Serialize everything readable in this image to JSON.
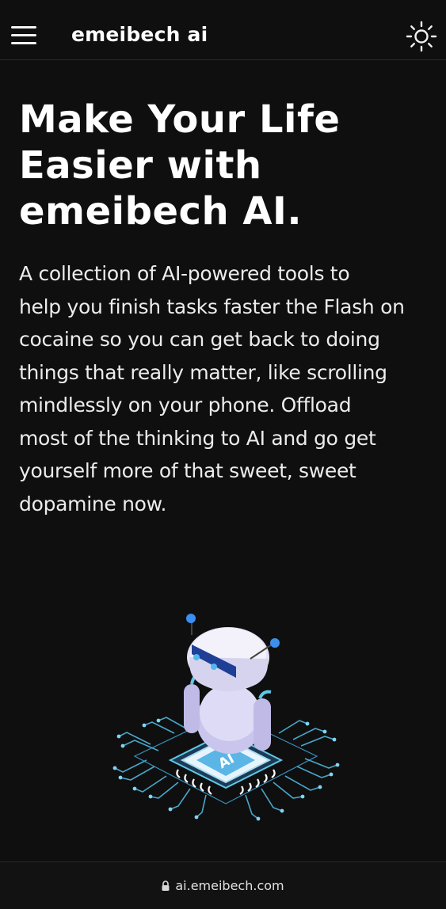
{
  "header": {
    "brand": "emeibech ai",
    "menu_icon": "hamburger-menu-icon",
    "theme_icon": "sun-icon"
  },
  "hero": {
    "title_lines": [
      "Make Your Life",
      "Easier with",
      "emeibech AI."
    ],
    "description_lines": [
      "A collection of AI-powered tools to",
      "help you finish tasks faster the Flash on",
      "cocaine so you can get back to doing",
      "things that really matter, like scrolling",
      "mindlessly on your phone. Offload",
      "most of the thinking to AI and go get",
      "yourself more of that sweet, sweet",
      "dopamine now."
    ],
    "illustration_chip_label": "AI"
  },
  "browser": {
    "url": "ai.emeibech.com",
    "lock_icon": "lock-icon"
  },
  "colors": {
    "background": "#0f0f10",
    "text": "#ffffff",
    "accent_blue": "#3b8ff0",
    "circuit_cyan": "#5ec8e8"
  }
}
